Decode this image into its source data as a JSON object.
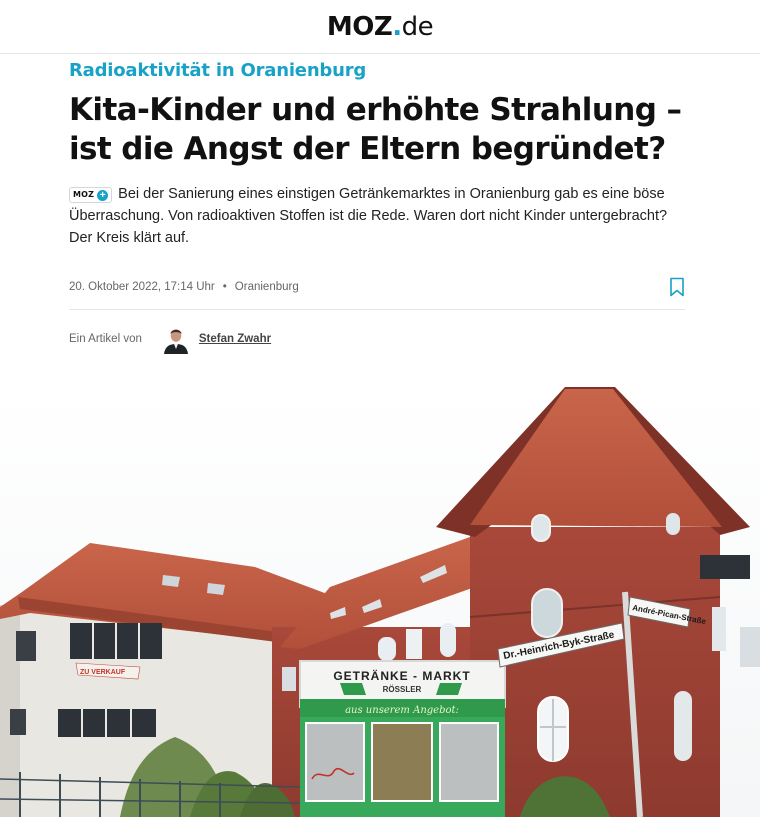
{
  "header": {
    "logo_brand": "MOZ",
    "logo_dot": ".",
    "logo_tld": "de"
  },
  "article": {
    "kicker": "Radioaktivität in Oranienburg",
    "headline": "Kita-Kinder und erhöhte Strahlung – ist die Angst der Eltern begründet?",
    "badge": {
      "label": "MOZ",
      "plus": "+"
    },
    "teaser": "Bei der Sanierung eines einstigen Getränkemarktes in Oranienburg gab es eine böse Überraschung. Von radioaktiven Stoffen ist die Rede. Waren dort nicht Kinder untergebracht? Der Kreis klärt auf.",
    "date": "20. Oktober 2022, 17:14 Uhr",
    "separator": "•",
    "location": "Oranienburg",
    "byline_prefix": "Ein Artikel von",
    "author": "Stefan Zwahr"
  },
  "photo": {
    "sign_market_title": "GETRÄNKE - MARKT",
    "sign_market_name": "RÖSSLER",
    "sign_market_slogan": "aus unserem Angebot:",
    "street_sign_1": "Dr.-Heinrich-Byk-Straße",
    "street_sign_2": "André-Pican-Straße",
    "banner_text": "ZU VERKAUF"
  },
  "colors": {
    "accent": "#18a2c5",
    "text": "#111111",
    "meta": "#666666"
  },
  "icons": [
    "bookmark-icon",
    "plus-icon",
    "avatar-photo"
  ]
}
